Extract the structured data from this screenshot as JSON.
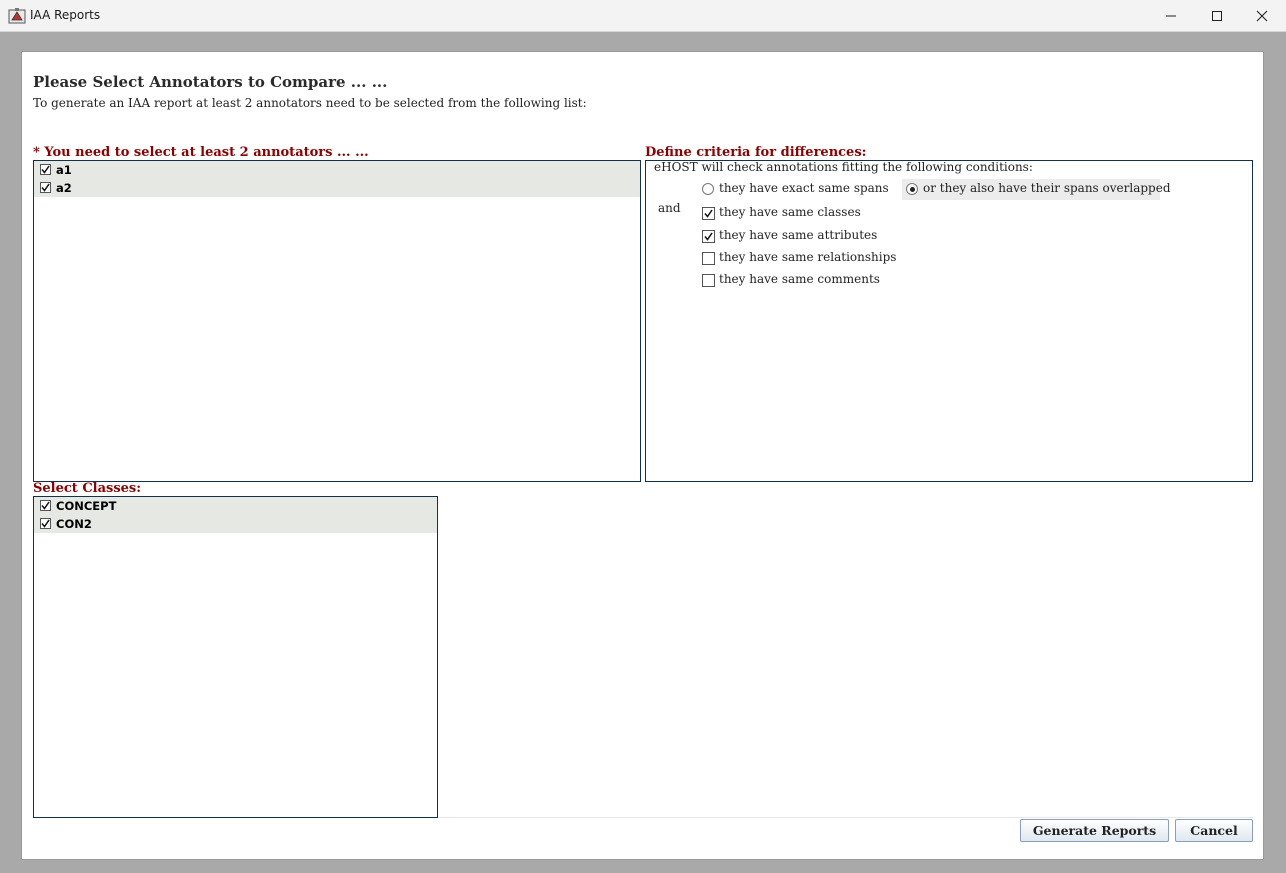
{
  "window": {
    "title": "IAA Reports",
    "icons": [
      "app-icon",
      "minimize-icon",
      "maximize-icon",
      "close-icon"
    ]
  },
  "header": {
    "title": "Please Select Annotators to Compare ... ...",
    "subtitle": "To generate an IAA report at least 2 annotators need to be selected from the following list:"
  },
  "annotators": {
    "label": "* You need to select at least 2 annotators ... ...",
    "items": [
      {
        "label": "a1",
        "checked": true
      },
      {
        "label": "a2",
        "checked": true
      }
    ]
  },
  "criteria": {
    "label": "Define criteria for differences:",
    "intro": "eHOST will check annotations fitting the following conditions:",
    "and_label": "and",
    "span_options": [
      {
        "label": "they have exact same spans",
        "selected": false
      },
      {
        "label": "or they also have their spans overlapped",
        "selected": true
      }
    ],
    "checks": [
      {
        "label": "they have same classes",
        "checked": true
      },
      {
        "label": "they have same attributes",
        "checked": true
      },
      {
        "label": "they have same relationships",
        "checked": false
      },
      {
        "label": "they have same comments",
        "checked": false
      }
    ]
  },
  "classes": {
    "label": "Select Classes:",
    "items": [
      {
        "label": "CONCEPT",
        "checked": true
      },
      {
        "label": "CON2",
        "checked": true
      }
    ]
  },
  "buttons": {
    "generate": "Generate Reports",
    "cancel": "Cancel"
  },
  "colors": {
    "section_label": "#8b0000",
    "selected_row": "#e6e8e3",
    "list_border": "#14304a"
  }
}
